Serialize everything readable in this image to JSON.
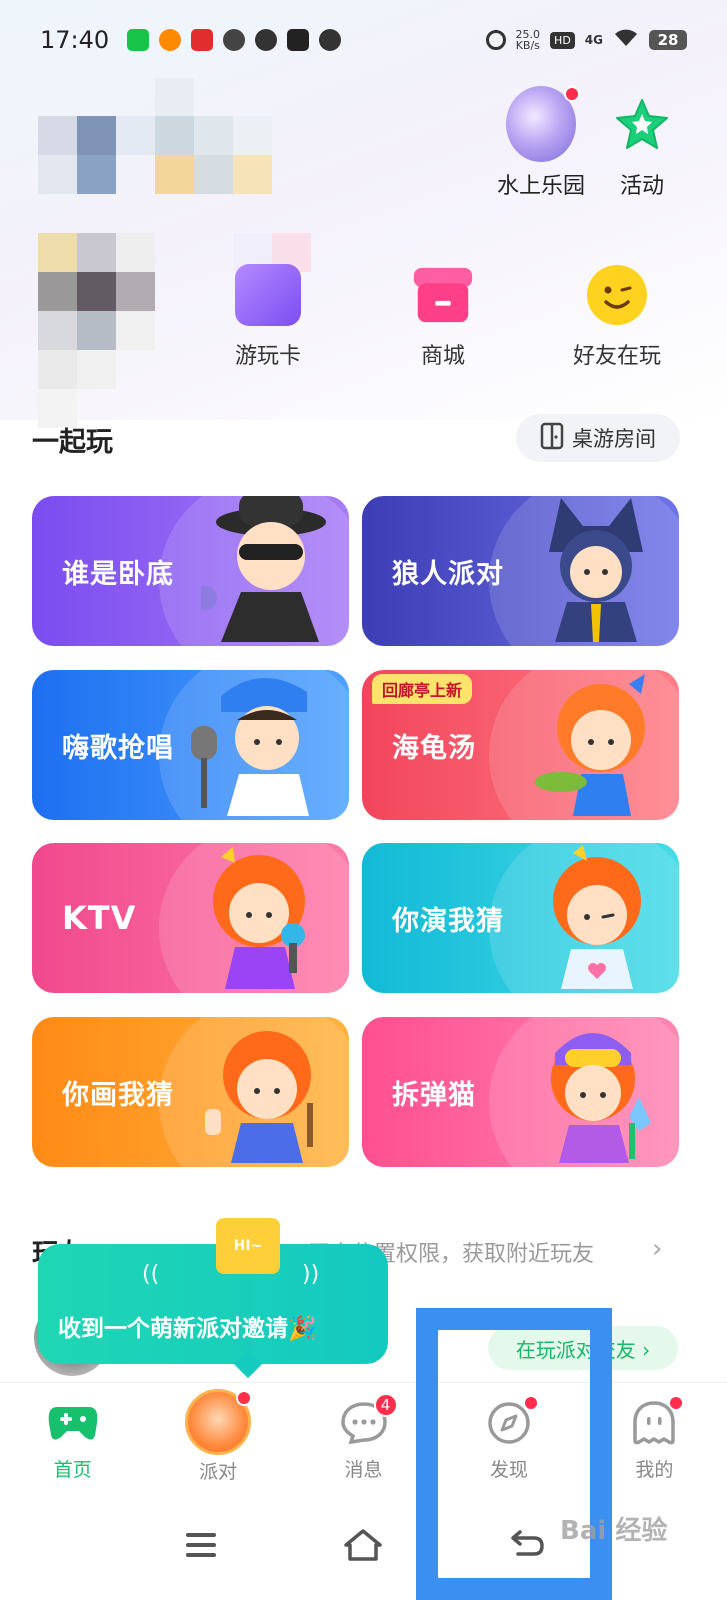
{
  "status_bar": {
    "time": "17:40",
    "net_speed_value": "25.0",
    "net_speed_unit": "KB/s",
    "hd": "HD",
    "signal": "4G",
    "battery": "28",
    "notification_icons": [
      "iqiyi-icon",
      "weibo-icon",
      "app-icon",
      "speed-icon",
      "wechat-icon",
      "tiktok-icon",
      "message-icon"
    ]
  },
  "top_actions": [
    {
      "label": "水上乐园",
      "icon": "water-park-globe-icon",
      "has_dot": true
    },
    {
      "label": "活动",
      "icon": "star-icon",
      "has_dot": false
    }
  ],
  "shortcuts": [
    {
      "label": "游玩卡",
      "icon": "play-card-icon"
    },
    {
      "label": "商城",
      "icon": "shop-icon"
    },
    {
      "label": "好友在玩",
      "icon": "friend-playing-icon"
    }
  ],
  "play_together": {
    "title": "一起玩",
    "board_room_button": "桌游房间",
    "games": [
      {
        "title": "谁是卧底",
        "color_from": "#7b4cf0",
        "color_to": "#a77cf7"
      },
      {
        "title": "狼人派对",
        "color_from": "#3d3db5",
        "color_to": "#6f73e8"
      },
      {
        "title": "嗨歌抢唱",
        "color_from": "#1d6ff0",
        "color_to": "#4fa2ff"
      },
      {
        "title": "海龟汤",
        "badge": "回廊亭上新",
        "color_from": "#f2455b",
        "color_to": "#ff7d86"
      },
      {
        "title": "KTV",
        "color_from": "#f0498d",
        "color_to": "#ff7aa8"
      },
      {
        "title": "你演我猜",
        "color_from": "#12b9d6",
        "color_to": "#45dbe8"
      },
      {
        "title": "你画我猜",
        "color_from": "#ff8a15",
        "color_to": "#ffb33f"
      },
      {
        "title": "拆弹猫",
        "color_from": "#ff4f8f",
        "color_to": "#ff86b3"
      }
    ]
  },
  "playmates": {
    "title": "玩友",
    "location_hint": "开启位置权限，获取附近玩友",
    "playing_tag": "在玩派对交友 ›"
  },
  "invite_popup": {
    "hi": "HI~",
    "text": "收到一个萌新派对邀请🎉"
  },
  "tabs": [
    {
      "label": "首页",
      "active": true
    },
    {
      "label": "派对",
      "active": false,
      "has_dot": true
    },
    {
      "label": "消息",
      "active": false,
      "badge": "4"
    },
    {
      "label": "发现",
      "active": false,
      "has_dot": true
    },
    {
      "label": "我的",
      "active": false,
      "has_dot": true
    }
  ],
  "colors": {
    "accent_green": "#17c06c",
    "highlight_blue": "#3b8ff0",
    "red_dot": "#ff2d4b"
  },
  "watermark": "Bai 经验"
}
